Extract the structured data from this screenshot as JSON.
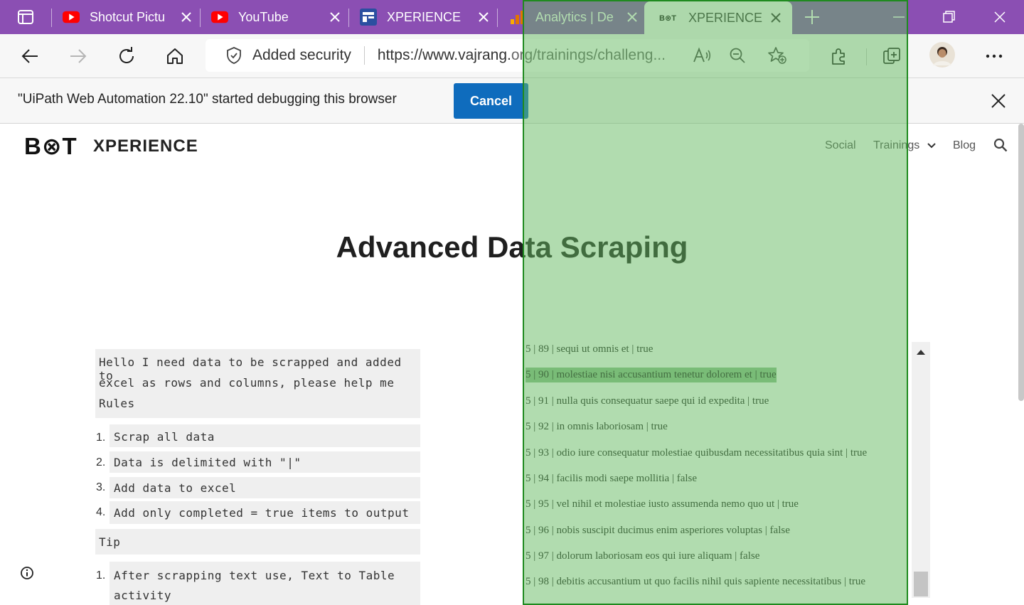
{
  "browser": {
    "tabs": [
      {
        "title": "Shotcut Pictu",
        "icon": "youtube-icon"
      },
      {
        "title": "YouTube",
        "icon": "youtube-icon"
      },
      {
        "title": "XPERIENCE",
        "icon": "site-icon"
      },
      {
        "title": "Analytics | De",
        "icon": "analytics-icon"
      },
      {
        "title": "XPERIENCE -",
        "icon": "bot-icon",
        "favicon_text": "B⊗T"
      }
    ],
    "security_label": "Added security",
    "url_primary": "https://www.vajrang.",
    "url_rest": "org/trainings/challeng...",
    "accent": "#8b4fb3"
  },
  "infobar": {
    "message": "\"UiPath Web Automation 22.10\" started debugging this browser",
    "cancel_label": "Cancel"
  },
  "site": {
    "logo": "B⊗T",
    "brand": "XPERIENCE",
    "nav": [
      "Social",
      "Trainings",
      "Blog"
    ]
  },
  "page": {
    "title": "Advanced Data Scraping",
    "intro_lines": [
      "Hello I need data to be scrapped and added to",
      "excel as rows and columns, please help me",
      "Rules"
    ],
    "rules": [
      {
        "num": "1.",
        "text": "Scrap all data"
      },
      {
        "num": "2.",
        "text": "Data is delimited with \"|\""
      },
      {
        "num": "3.",
        "text": "Add data to excel"
      },
      {
        "num": "4.",
        "text": "Add only completed = true items to output"
      }
    ],
    "tip_label": "Tip",
    "tips": [
      {
        "num": "1.",
        "text": "After scrapping text use, Text to Table"
      },
      {
        "num": "",
        "text": "activity"
      }
    ]
  },
  "data_rows": [
    "5 | 89 | sequi ut omnis et | true",
    "5 | 90 | molestiae nisi accusantium tenetur dolorem et | true",
    "5 | 91 | nulla quis consequatur saepe qui id expedita | true",
    "5 | 92 | in omnis laboriosam | true",
    "5 | 93 | odio iure consequatur molestiae quibusdam necessitatibus quia sint | true",
    "5 | 94 | facilis modi saepe mollitia | false",
    "5 | 95 | vel nihil et molestiae iusto assumenda nemo quo ut | true",
    "5 | 96 | nobis suscipit ducimus enim asperiores voluptas | false",
    "5 | 97 | dolorum laboriosam eos qui iure aliquam | false",
    "5 | 98 | debitis accusantium ut quo facilis nihil quis sapiente necessitatibus | true"
  ],
  "overlay_color": "#64b95f"
}
